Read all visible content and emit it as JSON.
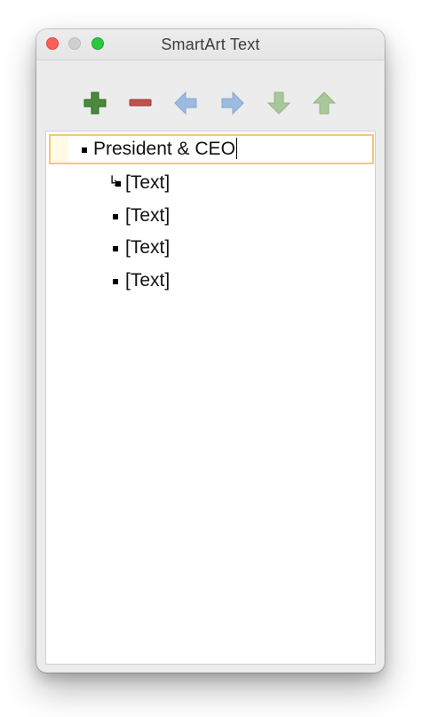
{
  "window": {
    "title": "SmartArt Text"
  },
  "toolbar": {
    "buttons": [
      {
        "name": "add",
        "icon": "plus-icon",
        "color": "#4a8a3a"
      },
      {
        "name": "remove",
        "icon": "minus-icon",
        "color": "#c0504d"
      },
      {
        "name": "promote",
        "icon": "arrow-left-icon",
        "color": "#9dbbe0"
      },
      {
        "name": "demote",
        "icon": "arrow-right-icon",
        "color": "#9dbbe0"
      },
      {
        "name": "move-down",
        "icon": "arrow-down-icon",
        "color": "#a9c79a"
      },
      {
        "name": "move-up",
        "icon": "arrow-up-icon",
        "color": "#a9c79a"
      }
    ]
  },
  "outline": {
    "items": [
      {
        "text": "President & CEO",
        "level": 1,
        "selected": true,
        "marker": "square"
      },
      {
        "text": "[Text]",
        "level": 2,
        "selected": false,
        "marker": "hook-square"
      },
      {
        "text": "[Text]",
        "level": 2,
        "selected": false,
        "marker": "square"
      },
      {
        "text": "[Text]",
        "level": 2,
        "selected": false,
        "marker": "square"
      },
      {
        "text": "[Text]",
        "level": 2,
        "selected": false,
        "marker": "square"
      }
    ]
  },
  "colors": {
    "selection_border": "#f3c979",
    "close": "#fe5f57",
    "zoom": "#28c840"
  }
}
